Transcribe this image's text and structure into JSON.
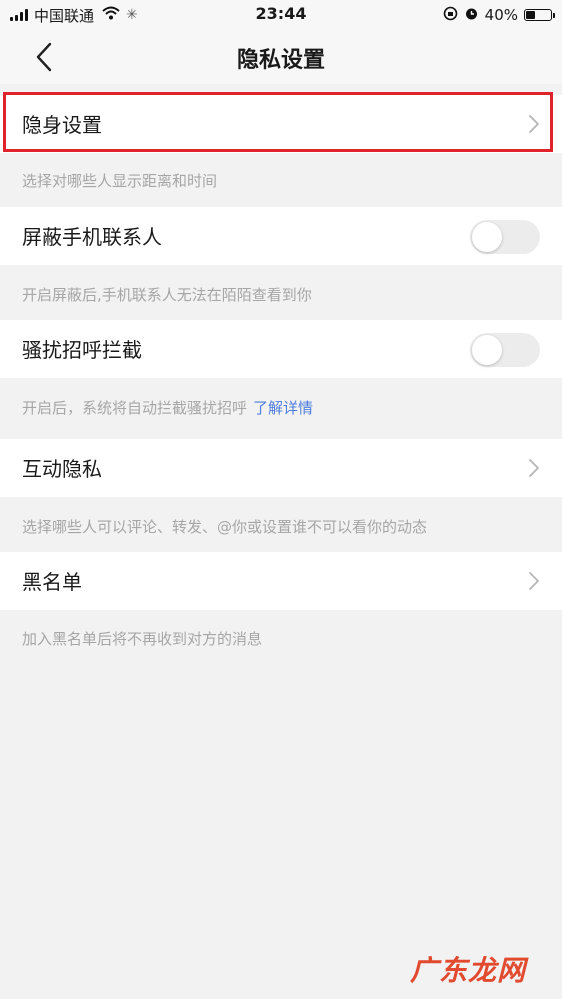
{
  "status_bar": {
    "carrier": "中国联通",
    "time": "23:44",
    "battery_percent": "40%",
    "battery_level": 0.4,
    "icons": [
      "signal-icon",
      "wifi-icon",
      "activity-icon",
      "orientation-lock-icon",
      "alarm-icon",
      "battery-icon"
    ]
  },
  "nav": {
    "title": "隐私设置",
    "back_icon": "chevron-left-icon"
  },
  "rows": {
    "stealth": {
      "label": "隐身设置"
    },
    "stealth_hint": "选择对哪些人显示距离和时间",
    "block_contacts": {
      "label": "屏蔽手机联系人",
      "enabled": false
    },
    "block_contacts_hint": "开启屏蔽后,手机联系人无法在陌陌查看到你",
    "harass_block": {
      "label": "骚扰招呼拦截",
      "enabled": false
    },
    "harass_hint": "开启后，系统将自动拦截骚扰招呼",
    "harass_hint_link": "了解详情",
    "interaction_privacy": {
      "label": "互动隐私"
    },
    "interaction_hint": "选择哪些人可以评论、转发、@你或设置谁不可以看你的动态",
    "blacklist": {
      "label": "黑名单"
    },
    "blacklist_hint": "加入黑名单后将不再收到对方的消息"
  },
  "colors": {
    "highlight": "#e0232b",
    "link": "#4d7ddf",
    "hint": "#a6a6a6",
    "background": "#f2f2f2"
  },
  "watermark": "广东龙网"
}
